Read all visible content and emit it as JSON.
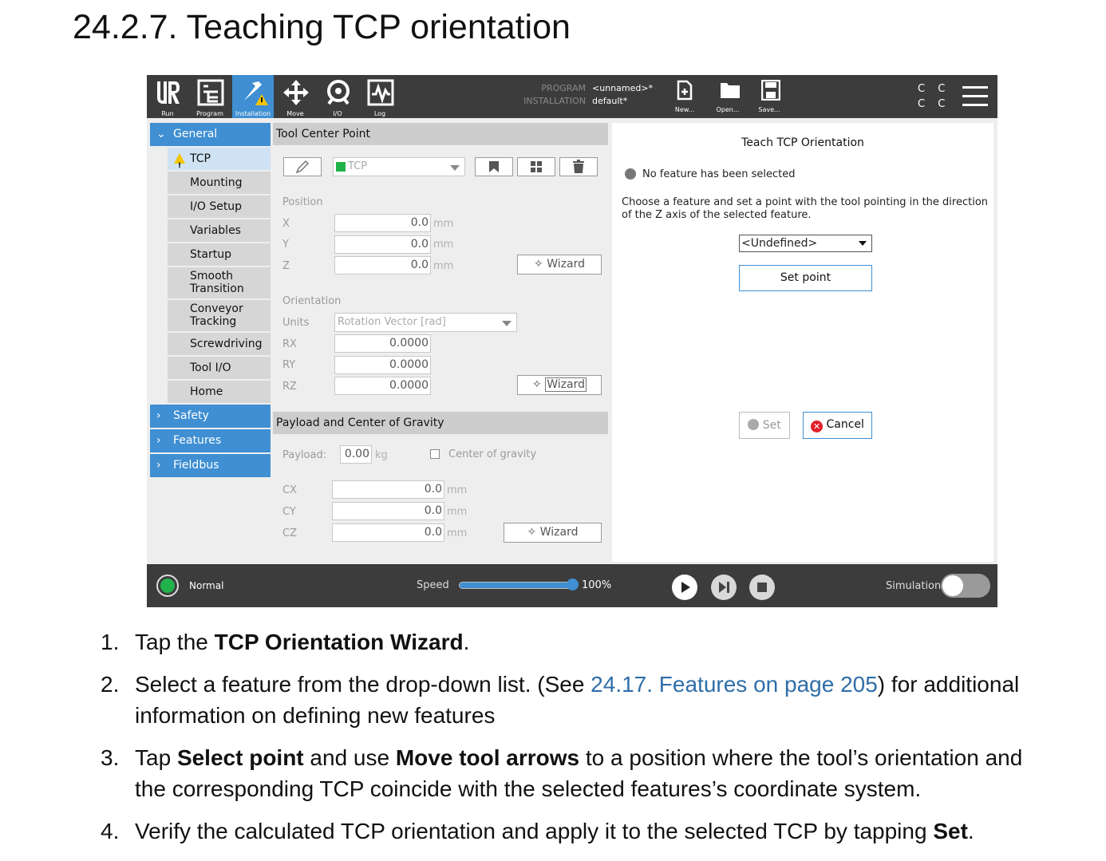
{
  "heading": "24.2.7. Teaching TCP orientation",
  "toolbar": {
    "run": "Run",
    "program": "Program",
    "installation": "Installation",
    "move": "Move",
    "io": "I/O",
    "log": "Log",
    "program_label": "PROGRAM",
    "program_value": "<unnamed>*",
    "installation_label": "INSTALLATION",
    "installation_value": "default*",
    "new": "New...",
    "open": "Open...",
    "save": "Save...",
    "cc": "C C C C"
  },
  "sidebar": {
    "general": "General",
    "items": [
      "TCP",
      "Mounting",
      "I/O Setup",
      "Variables",
      "Startup",
      "Smooth Transition",
      "Conveyor Tracking",
      "Screwdriving",
      "Tool I/O",
      "Home"
    ],
    "safety": "Safety",
    "features": "Features",
    "fieldbus": "Fieldbus"
  },
  "tcp": {
    "title": "Tool Center Point",
    "tcp_select": "TCP",
    "position_label": "Position",
    "x_label": "X",
    "y_label": "Y",
    "z_label": "Z",
    "x": "0.0",
    "y": "0.0",
    "z": "0.0",
    "unit_mm": "mm",
    "wizard": "Wizard",
    "orientation_label": "Orientation",
    "units_label": "Units",
    "units_value": "Rotation Vector [rad]",
    "rx_label": "RX",
    "ry_label": "RY",
    "rz_label": "RZ",
    "rx": "0.0000",
    "ry": "0.0000",
    "rz": "0.0000"
  },
  "payload": {
    "title": "Payload and Center of Gravity",
    "payload_label": "Payload:",
    "payload_value": "0.00",
    "unit_kg": "kg",
    "cog_label": "Center of gravity",
    "cx_label": "CX",
    "cy_label": "CY",
    "cz_label": "CZ",
    "cx": "0.0",
    "cy": "0.0",
    "cz": "0.0",
    "unit_mm": "mm",
    "wizard": "Wizard"
  },
  "teach": {
    "title": "Teach TCP Orientation",
    "status": "No feature has been selected",
    "instruction_1": "Choose a feature and set a point with the tool pointing in the direction",
    "instruction_2": "of the Z axis of the selected feature.",
    "feature_select": "<Undefined>",
    "set_point": "Set point",
    "set": "Set",
    "cancel": "Cancel"
  },
  "bottom": {
    "status": "Normal",
    "speed_label": "Speed",
    "speed_value": "100%",
    "speed_fraction": 1.0,
    "simulation": "Simulation"
  },
  "steps": [
    {
      "num": "1.",
      "pre": "Tap the ",
      "b1": "TCP Orientation Wizard",
      "post": "."
    },
    {
      "num": "2.",
      "pre": "Select a feature from the drop-down list. (See ",
      "link": "24.17. Features on page 205",
      "post": ") for additional information on defining new features"
    },
    {
      "num": "3.",
      "pre": "Tap ",
      "b1": "Select point",
      "mid": " and use ",
      "b2": "Move tool arrows",
      "post": " to a position where the tool’s orientation and the corresponding TCP coincide with the selected features’s coordinate system."
    },
    {
      "num": "4.",
      "pre": "Verify the calculated TCP orientation and apply it to the selected TCP by tapping ",
      "b1": "Set",
      "post": "."
    }
  ],
  "colors": {
    "accent": "#3f8fd2",
    "topbar": "#3c3c3c",
    "status_ok": "#21b34b",
    "cancel_red": "#e0202a",
    "link": "#2f6ea8"
  }
}
